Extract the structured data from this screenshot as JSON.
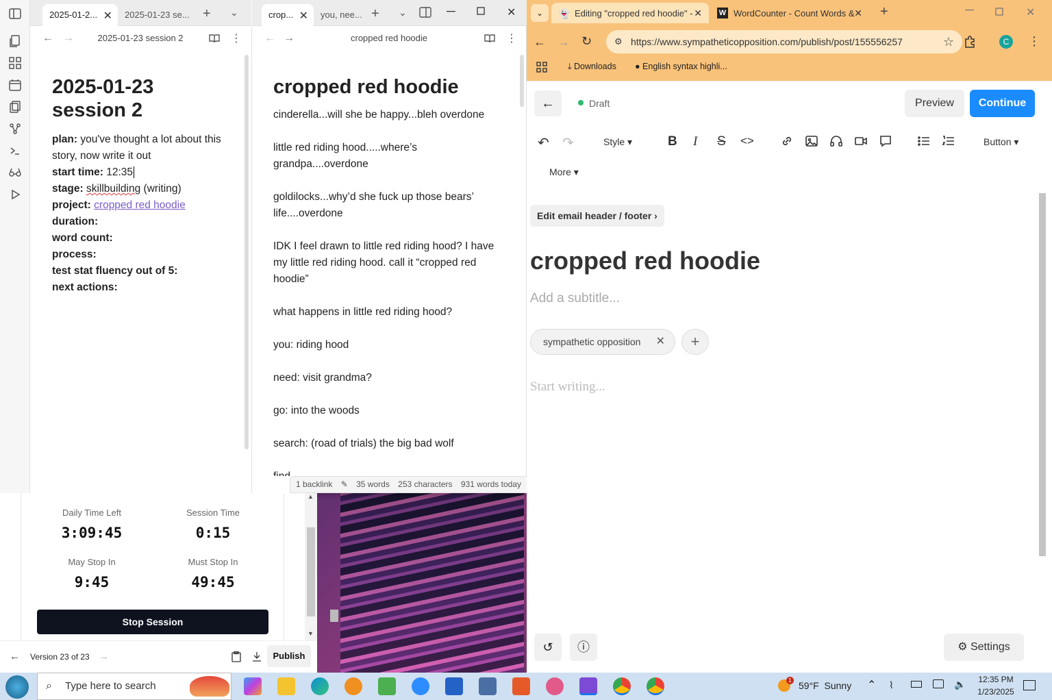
{
  "obsidian": {
    "left_tabs": [
      {
        "label": "2025-01-2..."
      },
      {
        "label": "2025-01-23 se..."
      }
    ],
    "right_tabs": [
      {
        "label": "crop..."
      },
      {
        "label": "you, nee..."
      }
    ],
    "left_pane": {
      "header": "2025-01-23 session 2",
      "title": "2025-01-23 session 2",
      "properties": [
        {
          "key": "plan:",
          "value": "you've thought a lot about this story, now write it out"
        },
        {
          "key": "start time:",
          "value": "12:35"
        },
        {
          "key": "stage:",
          "value_part1": "skillbuilding",
          "value_part2": " (writing)"
        },
        {
          "key": "project:",
          "value": "cropped red hoodie"
        },
        {
          "key": "duration:",
          "value": ""
        },
        {
          "key": "word count:",
          "value": ""
        },
        {
          "key": "process:",
          "value": ""
        },
        {
          "key": "test stat fluency out of 5:",
          "value": ""
        },
        {
          "key": "next actions:",
          "value": ""
        }
      ]
    },
    "right_pane": {
      "header": "cropped red hoodie",
      "title": "cropped red hoodie",
      "paragraphs": [
        "cinderella...will she be happy...bleh overdone",
        "little red riding hood.....where’s grandpa....overdone",
        "goldilocks...why’d she fuck up those bears’ life....overdone",
        "IDK I feel drawn to little red riding hood? I have my little red riding hood. call it “cropped red hoodie”",
        "what happens in little red riding hood?",
        "you: riding hood",
        "need: visit grandma?",
        "go: into the woods",
        "search: (road of trials) the big bad wolf",
        "find"
      ]
    },
    "status": {
      "backlinks": "1 backlink",
      "words": "35 words",
      "characters": "253 characters",
      "today": "931 words today"
    }
  },
  "timer": {
    "daily_time_left_label": "Daily Time Left",
    "daily_time_left": "3:09:45",
    "session_time_label": "Session Time",
    "session_time": "0:15",
    "may_stop_label": "May Stop In",
    "may_stop": "9:45",
    "must_stop_label": "Must Stop In",
    "must_stop": "49:45",
    "stop_button": "Stop Session",
    "version": "Version 23 of 23",
    "publish": "Publish"
  },
  "chrome": {
    "tabs": [
      {
        "label": "Editing \"cropped red hoodie\" -"
      },
      {
        "label": "WordCounter - Count Words &"
      }
    ],
    "url": "https://www.sympatheticopposition.com/publish/post/155556257",
    "bookmarks": [
      {
        "label": "Downloads"
      },
      {
        "label": "English syntax highli..."
      }
    ],
    "profile_initial": "C",
    "accent": "#f9c27a"
  },
  "editor": {
    "status": "Draft",
    "preview": "Preview",
    "continue": "Continue",
    "style": "Style",
    "button": "Button",
    "more": "More",
    "email_header": "Edit email header / footer",
    "title": "cropped red hoodie",
    "subtitle_placeholder": "Add a subtitle...",
    "tag": "sympathetic opposition",
    "body_placeholder": "Start writing...",
    "settings": "Settings",
    "accent": "#1a8cff"
  },
  "taskbar": {
    "search_placeholder": "Type here to search",
    "weather": "59°F  Sunny",
    "weather_badge": "1",
    "time": "12:35 PM",
    "date": "1/23/2025"
  }
}
